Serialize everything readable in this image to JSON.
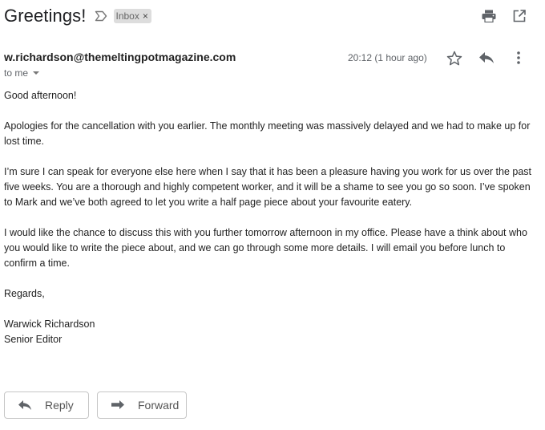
{
  "subject": "Greetings!",
  "label": {
    "name": "Inbox",
    "remove_glyph": "×"
  },
  "top_icons": [
    "print-icon",
    "open-in-new-window-icon"
  ],
  "message": {
    "sender": "w.richardson@themeltingpotmagazine.com",
    "recipient_label": "to me",
    "timestamp": "20:12 (1 hour ago)",
    "icons": [
      "star-icon",
      "reply-icon",
      "more-vert-icon"
    ],
    "body": {
      "greeting": "Good afternoon!",
      "paragraph_1": "Apologies for the cancellation with you earlier. The monthly meeting was massively delayed and we had to make up for lost time.",
      "paragraph_2": "I’m sure I can speak for everyone else here when I say that it has been a pleasure having you work for us over the past five weeks. You are a thorough and highly competent worker, and it will be a shame to see you go so soon. I’ve spoken to Mark and we’ve both agreed to let you write a half page piece about your favourite eatery.",
      "paragraph_3": "I would like the chance to discuss this with you further tomorrow afternoon in my office. Please have a think about who you would like to write the piece about, and we can go through some more details. I will email you before lunch to confirm a time.",
      "closing": "Regards,",
      "signature_name": "Warwick Richardson",
      "signature_title": "Senior Editor"
    }
  },
  "actions": {
    "reply_label": "Reply",
    "forward_label": "Forward"
  },
  "colors": {
    "text": "#222222",
    "muted": "#5f6368",
    "chip_bg": "#dddddd",
    "button_border": "#c6c6c6"
  }
}
